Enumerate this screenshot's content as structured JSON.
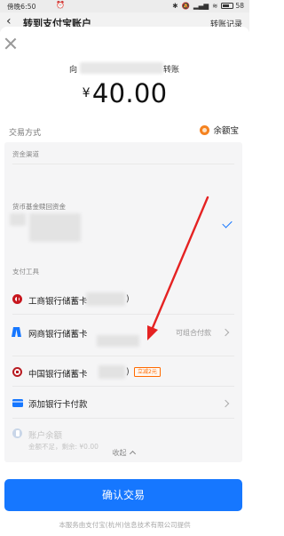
{
  "status_bar": {
    "time": "傍晚6:50",
    "alarm_glyph": "⏰",
    "bluetooth_glyph": "✱",
    "mute_glyph": "🔕",
    "signal_glyph": "▂▄▆",
    "wifi_glyph": "≋",
    "battery": "58"
  },
  "page": {
    "back_glyph": "‹",
    "title": "转到支付宝账户",
    "right_link": "转账记录"
  },
  "payment": {
    "payee_prefix": "向",
    "payee_suffix": "转账",
    "currency": "¥",
    "amount": "40.00",
    "method_label": "交易方式",
    "method_value": "余额宝"
  },
  "funds_section": {
    "title": "资金渠道",
    "subtitle": "货币基金赎回资金"
  },
  "pay_tools": {
    "title": "支付工具",
    "icbc": {
      "label": "工商银行储蓄卡",
      "paren": ")"
    },
    "mybank": {
      "label": "网商银行储蓄卡",
      "note": "可组合付款"
    },
    "boc": {
      "label": "中国银行储蓄卡",
      "paren": ")",
      "tag": "立减2元"
    },
    "add_card": {
      "label": "添加银行卡付款"
    },
    "balance": {
      "label": "账户余额",
      "sub": "金额不足，剩余: ¥0.00"
    },
    "collapse": "收起"
  },
  "confirm": {
    "label": "确认交易"
  },
  "footer": "本服务由支付宝(杭州)信息技术有限公司提供",
  "colors": {
    "primary": "#1677ff",
    "discount": "#ff6a00",
    "annotation_arrow": "#e52222"
  }
}
